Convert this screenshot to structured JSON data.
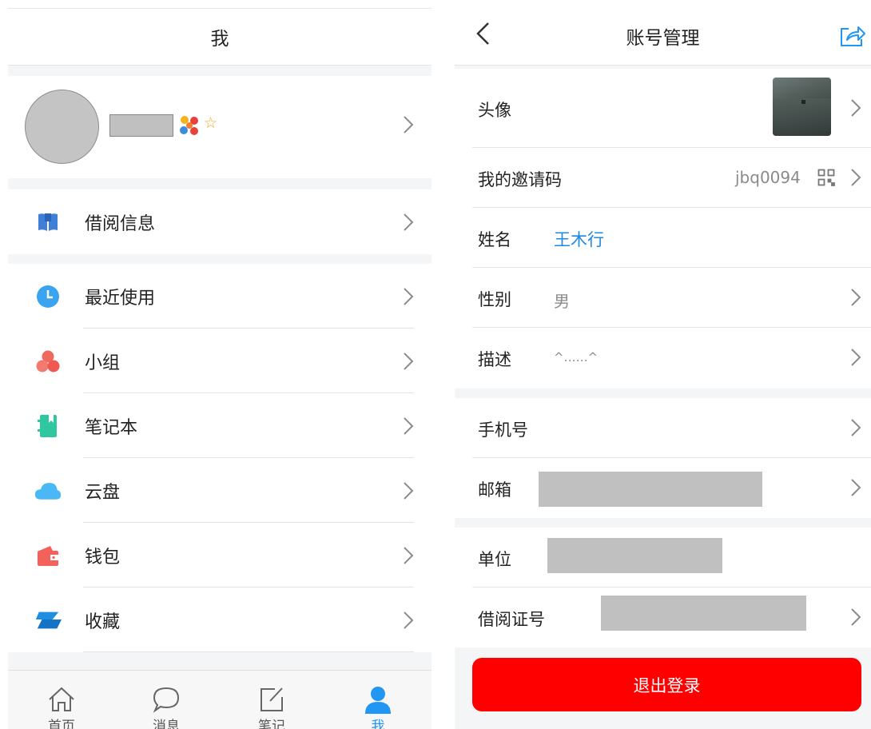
{
  "left": {
    "title": "我",
    "profile": {
      "avatar": "avatar-placeholder",
      "badges": [
        "flower-badge-icon",
        "star-outline-icon"
      ]
    },
    "group1": [
      {
        "label": "借阅信息",
        "icon": "book-icon",
        "color": "#3f7fd8"
      }
    ],
    "group2": [
      {
        "label": "最近使用",
        "icon": "clock-icon",
        "color": "#3aa4f0"
      },
      {
        "label": "小组",
        "icon": "group-icon",
        "color": "#f0695f"
      },
      {
        "label": "笔记本",
        "icon": "notebook-icon",
        "color": "#2fc7a0"
      },
      {
        "label": "云盘",
        "icon": "cloud-icon",
        "color": "#4ab8f4"
      },
      {
        "label": "钱包",
        "icon": "wallet-icon",
        "color": "#f4605a"
      },
      {
        "label": "收藏",
        "icon": "favorites-icon",
        "color": "#1f8ee0"
      }
    ],
    "tabs": [
      {
        "label": "首页",
        "icon": "home-icon",
        "active": false
      },
      {
        "label": "消息",
        "icon": "message-icon",
        "active": false
      },
      {
        "label": "笔记",
        "icon": "note-icon",
        "active": false
      },
      {
        "label": "我",
        "icon": "person-icon",
        "active": true
      }
    ]
  },
  "right": {
    "title": "账号管理",
    "back_icon": "chevron-left-icon",
    "share_icon": "share-icon",
    "rows": {
      "avatar": {
        "label": "头像"
      },
      "invite": {
        "label": "我的邀请码",
        "value": "jbq0094"
      },
      "name": {
        "label": "姓名",
        "value": "王木行"
      },
      "gender": {
        "label": "性别",
        "value": "男"
      },
      "desc": {
        "label": "描述",
        "value": "^……^"
      },
      "phone": {
        "label": "手机号"
      },
      "email": {
        "label": "邮箱"
      },
      "unit": {
        "label": "单位"
      },
      "card": {
        "label": "借阅证号"
      }
    },
    "logout": "退出登录"
  },
  "colors": {
    "accent": "#2196f3",
    "danger": "#ff0000",
    "link": "#1e88e5"
  }
}
